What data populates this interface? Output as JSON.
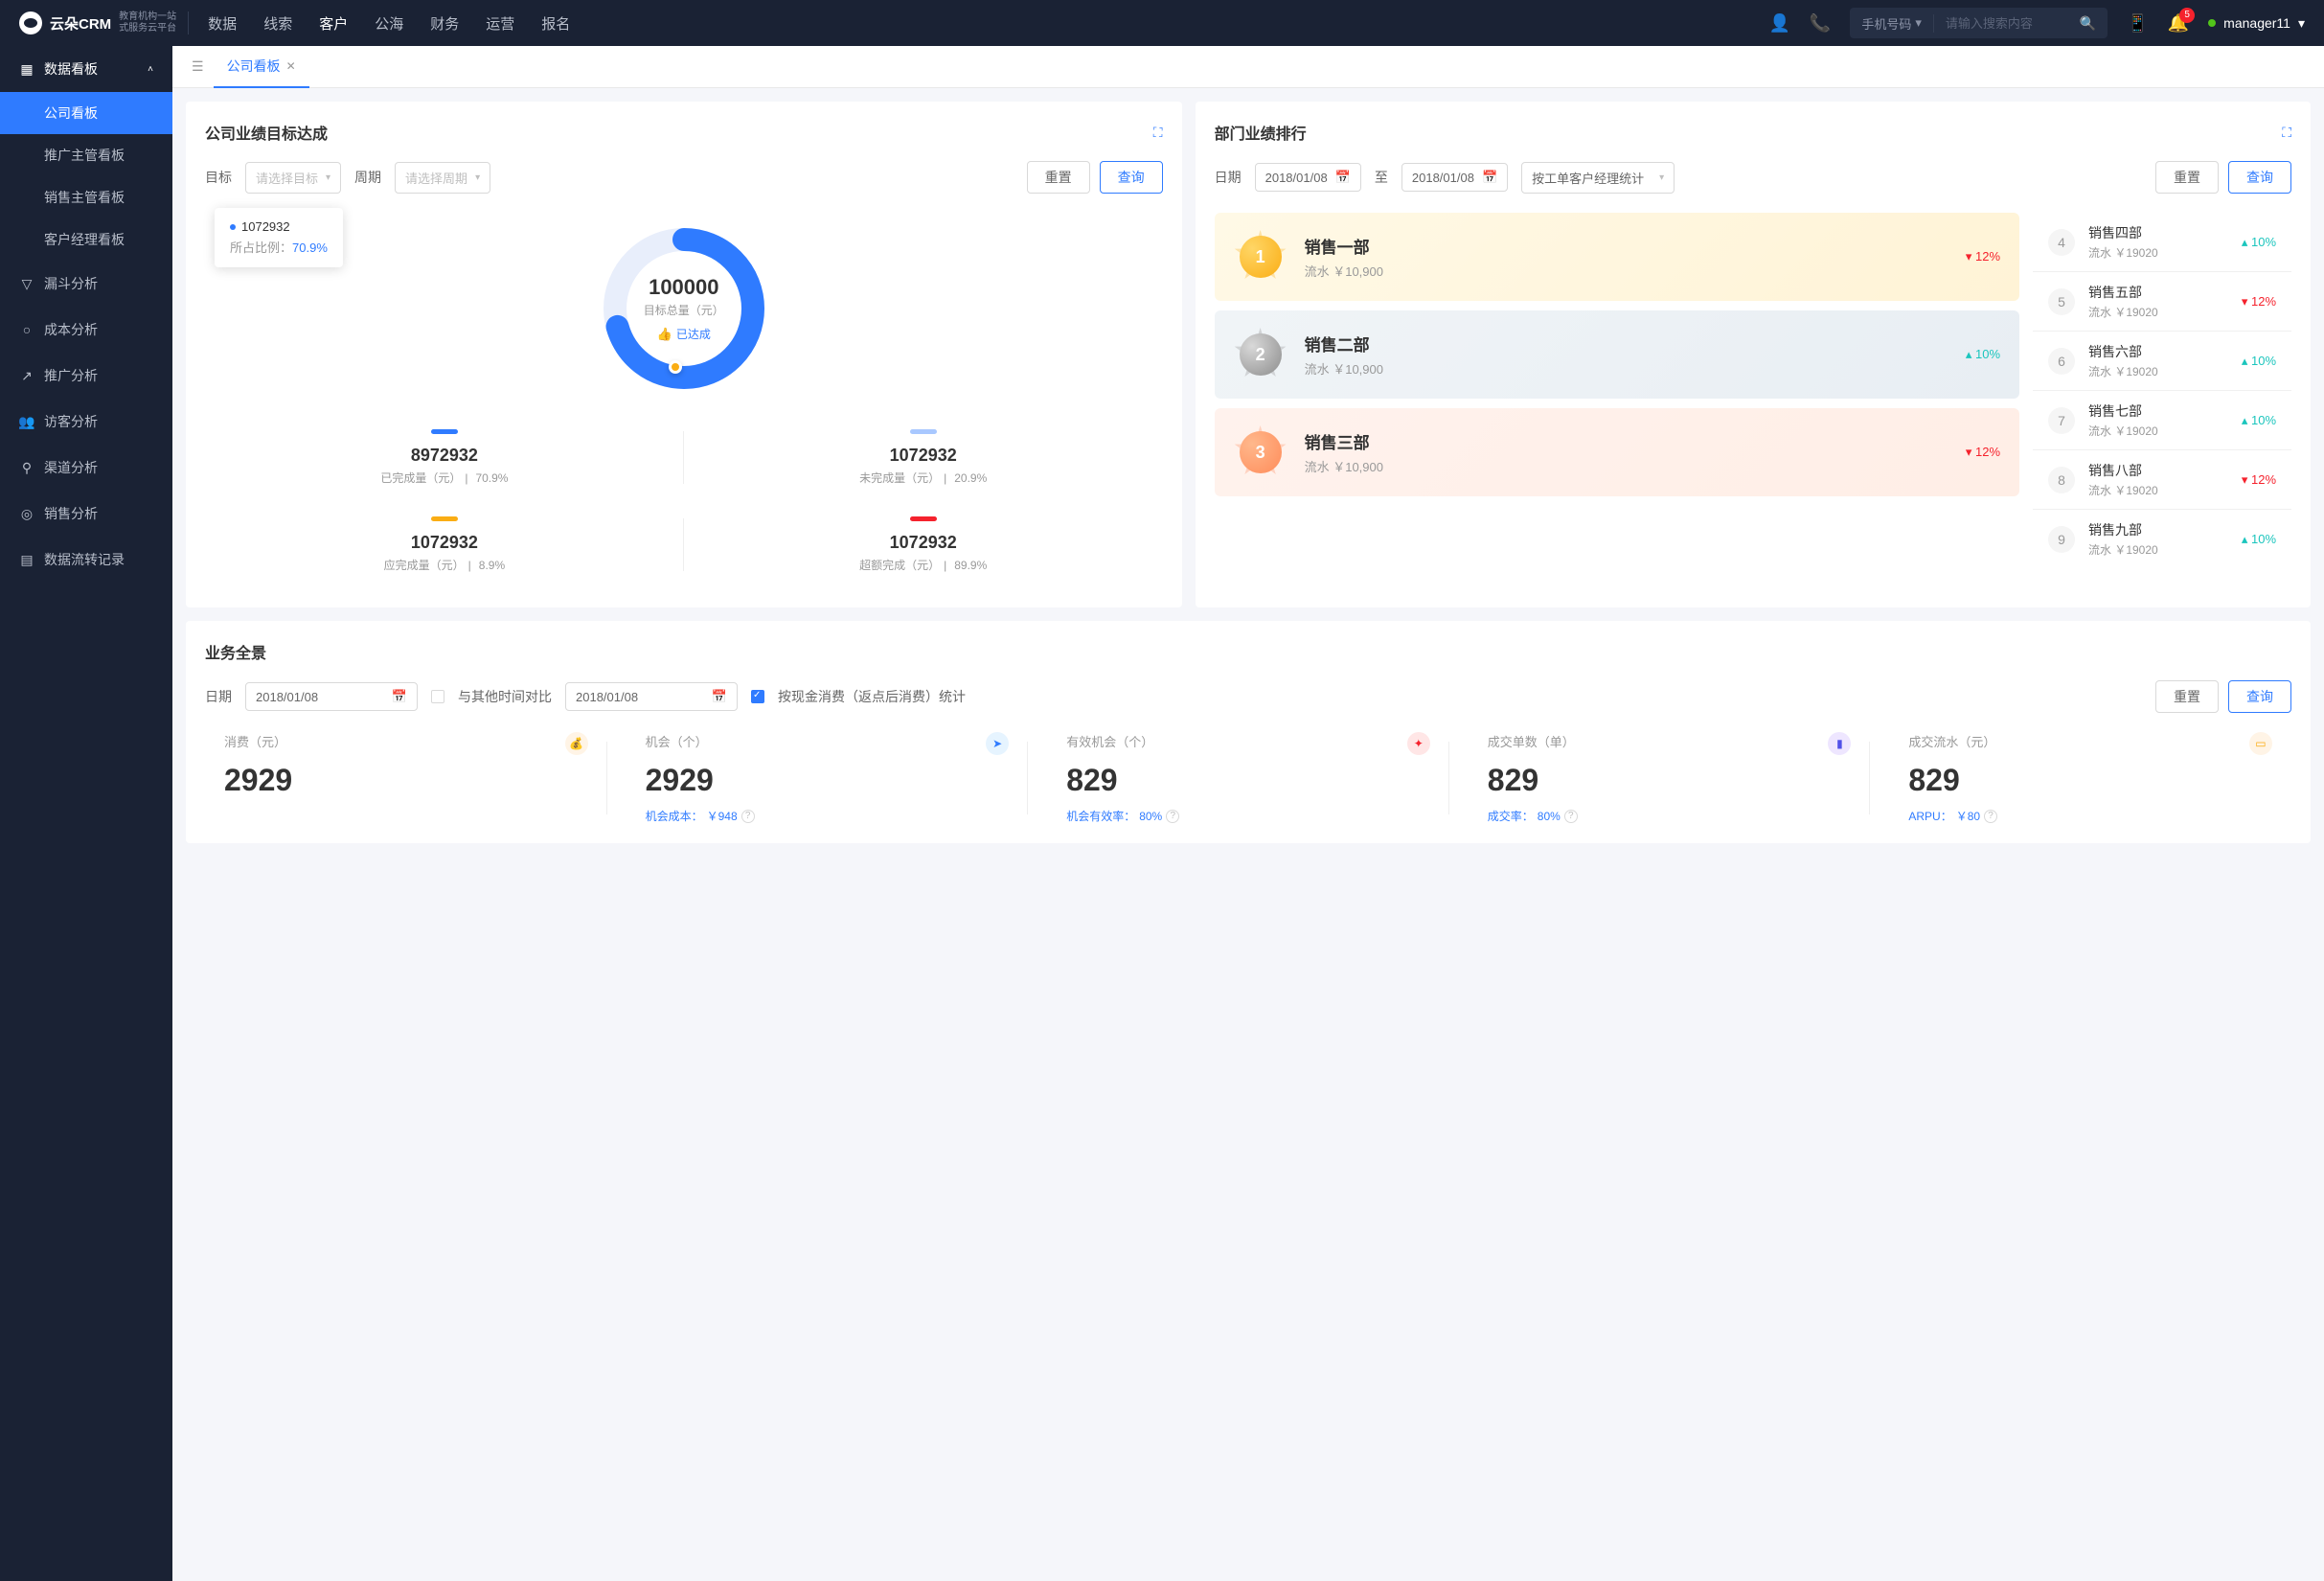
{
  "header": {
    "logo_text": "云朵CRM",
    "logo_sub1": "教育机构一站",
    "logo_sub2": "式服务云平台",
    "nav": [
      "数据",
      "线索",
      "客户",
      "公海",
      "财务",
      "运营",
      "报名"
    ],
    "active_nav": 2,
    "search_type": "手机号码",
    "search_placeholder": "请输入搜索内容",
    "badge_count": "5",
    "user": "manager11"
  },
  "sidebar": {
    "group1": {
      "label": "数据看板",
      "expanded": true,
      "items": [
        "公司看板",
        "推广主管看板",
        "销售主管看板",
        "客户经理看板"
      ],
      "active": 0
    },
    "items": [
      "漏斗分析",
      "成本分析",
      "推广分析",
      "访客分析",
      "渠道分析",
      "销售分析",
      "数据流转记录"
    ]
  },
  "tabs": {
    "active": "公司看板"
  },
  "goal_card": {
    "title": "公司业绩目标达成",
    "filters": {
      "target_label": "目标",
      "target_ph": "请选择目标",
      "period_label": "周期",
      "period_ph": "请选择周期",
      "reset": "重置",
      "query": "查询"
    },
    "donut": {
      "value": "100000",
      "label": "目标总量（元）",
      "badge": "已达成"
    },
    "tooltip": {
      "value": "1072932",
      "ratio_label": "所占比例：",
      "ratio": "70.9%"
    },
    "stats": [
      {
        "bar": "bar-blue",
        "value": "8972932",
        "label": "已完成量（元）",
        "pct": "70.9%"
      },
      {
        "bar": "bar-lightblue",
        "value": "1072932",
        "label": "未完成量（元）",
        "pct": "20.9%"
      },
      {
        "bar": "bar-orange",
        "value": "1072932",
        "label": "应完成量（元）",
        "pct": "8.9%"
      },
      {
        "bar": "bar-red",
        "value": "1072932",
        "label": "超额完成（元）",
        "pct": "89.9%"
      }
    ]
  },
  "rank_card": {
    "title": "部门业绩排行",
    "filters": {
      "date_label": "日期",
      "date1": "2018/01/08",
      "to": "至",
      "date2": "2018/01/08",
      "type": "按工单客户经理统计",
      "reset": "重置",
      "query": "查询"
    },
    "top3": [
      {
        "name": "销售一部",
        "revenue": "流水 ￥10,900",
        "change": "12%",
        "dir": "down"
      },
      {
        "name": "销售二部",
        "revenue": "流水 ￥10,900",
        "change": "10%",
        "dir": "up"
      },
      {
        "name": "销售三部",
        "revenue": "流水 ￥10,900",
        "change": "12%",
        "dir": "down"
      }
    ],
    "rest": [
      {
        "num": "4",
        "name": "销售四部",
        "revenue": "流水 ￥19020",
        "change": "10%",
        "dir": "up"
      },
      {
        "num": "5",
        "name": "销售五部",
        "revenue": "流水 ￥19020",
        "change": "12%",
        "dir": "down"
      },
      {
        "num": "6",
        "name": "销售六部",
        "revenue": "流水 ￥19020",
        "change": "10%",
        "dir": "up"
      },
      {
        "num": "7",
        "name": "销售七部",
        "revenue": "流水 ￥19020",
        "change": "10%",
        "dir": "up"
      },
      {
        "num": "8",
        "name": "销售八部",
        "revenue": "流水 ￥19020",
        "change": "12%",
        "dir": "down"
      },
      {
        "num": "9",
        "name": "销售九部",
        "revenue": "流水 ￥19020",
        "change": "10%",
        "dir": "up"
      }
    ]
  },
  "overview_card": {
    "title": "业务全景",
    "filters": {
      "date_label": "日期",
      "date1": "2018/01/08",
      "compare_label": "与其他时间对比",
      "date2": "2018/01/08",
      "stat_label": "按现金消费（返点后消费）统计",
      "reset": "重置",
      "query": "查询"
    },
    "items": [
      {
        "label": "消费（元）",
        "value": "2929",
        "meta": "",
        "icon": "ic-orange",
        "glyph": "💰"
      },
      {
        "label": "机会（个）",
        "value": "2929",
        "meta_label": "机会成本：",
        "meta_val": "￥948",
        "icon": "ic-blue",
        "glyph": "➤"
      },
      {
        "label": "有效机会（个）",
        "value": "829",
        "meta_label": "机会有效率：",
        "meta_val": "80%",
        "icon": "ic-red",
        "glyph": "✦"
      },
      {
        "label": "成交单数（单）",
        "value": "829",
        "meta_label": "成交率：",
        "meta_val": "80%",
        "icon": "ic-purple",
        "glyph": "▮"
      },
      {
        "label": "成交流水（元）",
        "value": "829",
        "meta_label": "ARPU：",
        "meta_val": "￥80",
        "icon": "ic-orange",
        "glyph": "▭"
      }
    ]
  },
  "chart_data": {
    "type": "pie",
    "title": "公司业绩目标达成",
    "total_label": "目标总量（元）",
    "total": 100000,
    "series": [
      {
        "name": "已完成量",
        "value": 8972932,
        "pct": 70.9,
        "color": "#2f7bff"
      },
      {
        "name": "未完成量",
        "value": 1072932,
        "pct": 20.9,
        "color": "#a8c8ff"
      },
      {
        "name": "应完成量",
        "value": 1072932,
        "pct": 8.9,
        "color": "#faad14"
      },
      {
        "name": "超额完成",
        "value": 1072932,
        "pct": 89.9,
        "color": "#f5222d"
      }
    ]
  }
}
